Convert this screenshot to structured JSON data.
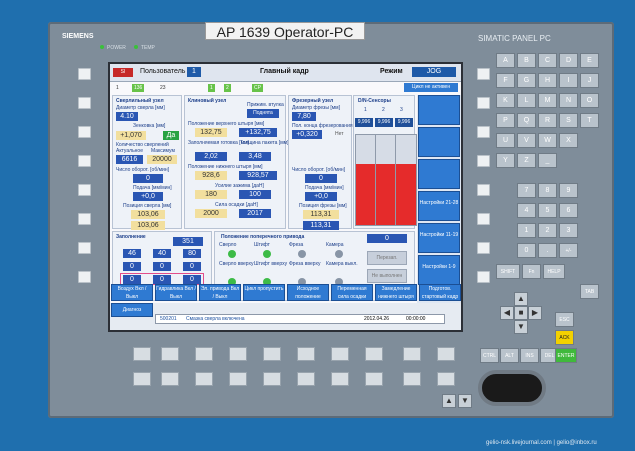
{
  "device": {
    "sticker": "AP 1639 Operator-PC",
    "brand": "SIEMENS",
    "panel_name": "SIMATIC PANEL PC",
    "leds": [
      "POWER",
      "TEMP"
    ]
  },
  "topbar": {
    "user_label": "Пользователь",
    "user_value": "1",
    "main": "Главный кадр",
    "mode_label": "Режим",
    "mode_value": "JOG",
    "cycle_status": "Цикл не активен",
    "icons_row": [
      "1",
      "136",
      "23",
      "1",
      "2",
      "CP"
    ]
  },
  "drill": {
    "title": "Сверлильный узел",
    "diameter_label": "Диаметр сверла [мм]",
    "diameter": "4.10",
    "resolution_label": "Зенковка [мм]",
    "resolution": "+1,070",
    "yes": "Да",
    "count_label": "Количество сверлений",
    "actual_label": "Актуальное",
    "max_label": "Максимум",
    "actual": "6616",
    "max": "20000",
    "rpm_label": "Число оборот. [об/мин]",
    "rpm": "0",
    "feed_label": "Подача [мм/мин]",
    "feed": "+0,0",
    "pos_label": "Позиция сверла [мм]",
    "pos1": "103,06",
    "pos2": "103,06"
  },
  "wedge": {
    "title": "Клиновый узел",
    "press_label": "Прижим. втулка",
    "press_value": "Поднята",
    "upper_label": "Положение верхнего штыря [мм]",
    "upper1": "132,75",
    "upper2": "+132,75",
    "thick_label": "Заполняемая готовка [мм]",
    "thick1": "2,02",
    "pack_label": "Толщина пакета [мм]",
    "pack": "3,48",
    "lower_label": "Положение нижнего штыря [мм]",
    "lower1": "928,6",
    "lower2": "928,57",
    "force_label": "Усилие зажима [даН]",
    "force": "180",
    "force2": "100",
    "riv_label": "Сила осадки [даН]",
    "riv1": "2000",
    "riv2": "2017"
  },
  "mill": {
    "title": "Фрезерный узел",
    "dia_label": "Диаметр фрезы [мм]",
    "dia": "7,80",
    "pos_label": "Пол. конца фрезерования",
    "pos": "+0,320",
    "no": "Нет",
    "rpm_label": "Число оборот. [об/мин]",
    "rpm": "0",
    "feed_label": "Подача [мм/мин]",
    "feed": "+0,0",
    "mill_pos_label": "Позиция фрезы [мм]",
    "mill_pos1": "113,31",
    "mill_pos2": "113,31"
  },
  "sensors": {
    "title": "D/N-Сенсоры",
    "headers": [
      "1",
      "2",
      "3"
    ],
    "values": [
      "9,996",
      "9,996",
      "9,996"
    ],
    "levels": [
      0.68,
      0.68,
      0.68
    ]
  },
  "clamp": {
    "title": "Заполнение",
    "value": "351",
    "row1": [
      "46",
      "40",
      "80"
    ],
    "row2": [
      "0",
      "0",
      "0"
    ],
    "row3": [
      "0",
      "0",
      "0"
    ]
  },
  "transverse": {
    "title": "Положение поперечного привода",
    "columns": [
      "Сверло",
      "Штифт",
      "Фреза",
      "Камера"
    ],
    "row2": [
      "Сверло вверху",
      "Штифт вверху",
      "Фреза вверху",
      "Камера выкл."
    ],
    "counter": "0",
    "btn_restart": "Перезап.",
    "btn_not_done": "Не выполнен"
  },
  "rightbuttons": {
    "b1": "Настройки 21-28",
    "b2": "Настройки 11-19",
    "b3": "Настройки 1-9"
  },
  "footer": {
    "buttons": [
      "Воздух Вкл / Выкл",
      "Гидравлика Вкл / Выкл",
      "Эл. привода Вкл / Выкл",
      "Цикл пропустить",
      "Исходное положение",
      "Переменная сила осадки",
      "Замедление нижнего штыря",
      "Подготов. стартовый кадр"
    ],
    "left_button": "Диагноз",
    "status_code": "500201",
    "status_text": "Смазка сверла включена",
    "status_date": "2012.04.26",
    "status_time": "00:00:00"
  },
  "keyboard": {
    "letters": [
      "A",
      "B",
      "C",
      "D",
      "E",
      "F",
      "G",
      "H",
      "I",
      "J",
      "K",
      "L",
      "M",
      "N",
      "O",
      "P",
      "Q",
      "R",
      "S",
      "T",
      "U",
      "V",
      "W",
      "X",
      "Y",
      "Z",
      "_",
      "7",
      "8",
      "9",
      "4",
      "5",
      "6",
      "1",
      "2",
      "3",
      "0",
      ".",
      "+/-"
    ],
    "special": [
      "SHIFT",
      "Fn",
      "HELP",
      "TAB",
      "ESC",
      "ACK",
      "CTRL",
      "ALT",
      "INS",
      "DEL",
      "ENTER"
    ]
  },
  "credit": "gelio-nsk.livejournal.com | gelio@inbox.ru"
}
